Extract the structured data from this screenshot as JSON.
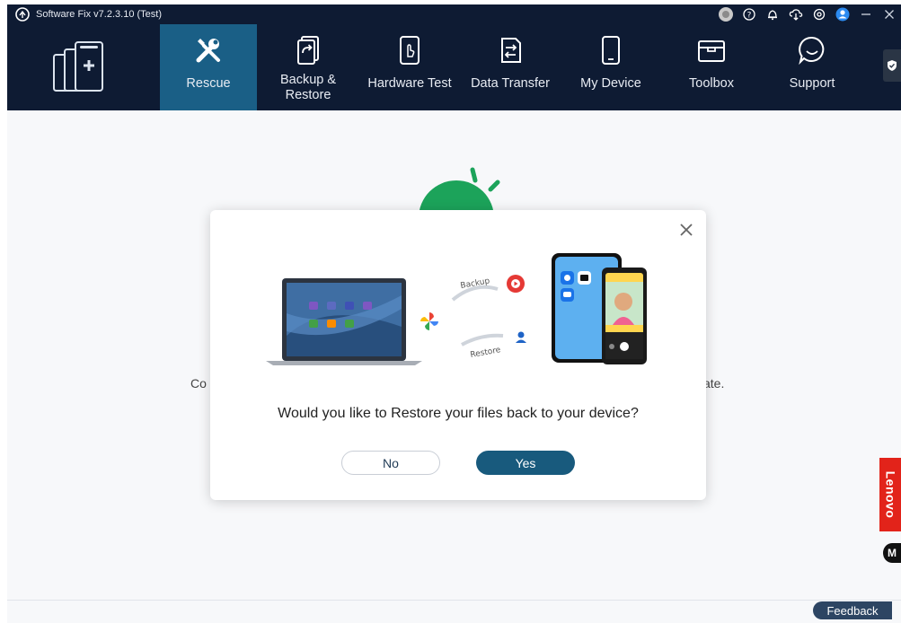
{
  "window": {
    "title": "Software Fix v7.2.3.10 (Test)"
  },
  "titlebar_icons": [
    "profile-photo-icon",
    "help-icon",
    "bell-icon",
    "cloud-download-icon",
    "settings-icon",
    "account-icon",
    "minimize-icon",
    "close-icon"
  ],
  "nav": {
    "items": [
      {
        "label": "Rescue",
        "icon": "wrench-screwdriver-icon",
        "active": true
      },
      {
        "label": "Backup & Restore",
        "icon": "backup-restore-icon",
        "active": false
      },
      {
        "label": "Hardware Test",
        "icon": "hardware-test-icon",
        "active": false
      },
      {
        "label": "Data Transfer",
        "icon": "data-transfer-icon",
        "active": false
      },
      {
        "label": "My Device",
        "icon": "phone-icon",
        "active": false
      },
      {
        "label": "Toolbox",
        "icon": "toolbox-icon",
        "active": false
      },
      {
        "label": "Support",
        "icon": "chat-icon",
        "active": false
      }
    ]
  },
  "background": {
    "text_left_fragment": "Co",
    "text_right_fragment": "ate."
  },
  "dialog": {
    "backup_label": "Backup",
    "restore_label": "Restore",
    "question": "Would you like to Restore your files back to your device?",
    "no_label": "No",
    "yes_label": "Yes"
  },
  "side": {
    "lenovo_label": "Lenovo",
    "moto_label": "M"
  },
  "footer": {
    "feedback_label": "Feedback"
  },
  "colors": {
    "nav_bg": "#0e1b33",
    "nav_active": "#1a5f86",
    "primary_button": "#185a7d",
    "lenovo_red": "#e2231a"
  }
}
